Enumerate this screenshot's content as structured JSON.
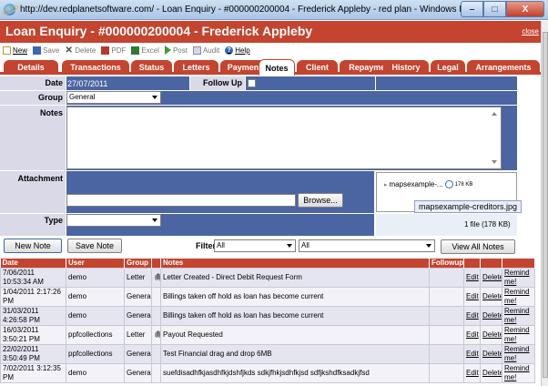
{
  "window": {
    "title": "http://dev.redplanetsoftware.com/ - Loan Enquiry - #000000200004 - Frederick Appleby - red plan - Windows Internet Explorer",
    "min": "–",
    "max": "□",
    "close": "X"
  },
  "header": {
    "title": "Loan Enquiry - #000000200004 - Frederick Appleby",
    "close": "close"
  },
  "toolbar": [
    {
      "label": "New",
      "icon": "new-icon",
      "active": true
    },
    {
      "label": "Save",
      "icon": "save-icon",
      "active": false
    },
    {
      "label": "Delete",
      "icon": "delete-icon",
      "active": false
    },
    {
      "label": "PDF",
      "icon": "pdf-icon",
      "active": false
    },
    {
      "label": "Excel",
      "icon": "excel-icon",
      "active": false
    },
    {
      "label": "Post",
      "icon": "post-icon",
      "active": false
    },
    {
      "label": "Audit",
      "icon": "audit-icon",
      "active": false
    },
    {
      "label": "Help",
      "icon": "help-icon",
      "active": true
    }
  ],
  "tabs": [
    "Details",
    "Transactions",
    "Status",
    "Letters",
    "Payments",
    "Notes",
    "Client",
    "Repayments",
    "History",
    "Legal",
    "Arrangements"
  ],
  "active_tab": "Notes",
  "form": {
    "date_label": "Date",
    "date_value": "27/07/2011",
    "followup_label": "Follow Up",
    "group_label": "Group",
    "group_value": "General",
    "notes_label": "Notes",
    "attachment_label": "Attachment",
    "attachment_file": "mapsexample-...",
    "attachment_size": "178 KB",
    "attachment_tooltip": "mapsexample-creditors.jpg",
    "attachment_count": "1 file (178 KB)",
    "browse_label": "Browse...",
    "type_label": "Type",
    "type_value": ""
  },
  "actions": {
    "new_note": "New Note",
    "save_note": "Save Note",
    "filter_label": "Filter",
    "filter_1": "All",
    "filter_2": "All",
    "view_all": "View All Notes"
  },
  "table": {
    "headers": [
      "Date",
      "User",
      "Group",
      "",
      "Notes",
      "Followup",
      "",
      "",
      ""
    ],
    "rows": [
      {
        "date": "7/06/2011 10:53:34 AM",
        "user": "demo",
        "group": "Letter",
        "clip": "🖇",
        "notes": "Letter Created - Direct Debit Request Form",
        "followup": "",
        "edit": "Edit",
        "delete": "Delete",
        "remind": "Remind me!"
      },
      {
        "date": "1/04/2011 2:17:26 PM",
        "user": "demo",
        "group": "General",
        "clip": "",
        "notes": "Billings taken off hold as loan has become current",
        "followup": "",
        "edit": "Edit",
        "delete": "Delete",
        "remind": "Remind me!"
      },
      {
        "date": "31/03/2011 4:26:58 PM",
        "user": "demo",
        "group": "General",
        "clip": "",
        "notes": "Billings taken off hold as loan has become current",
        "followup": "",
        "edit": "Edit",
        "delete": "Delete",
        "remind": "Remind me!"
      },
      {
        "date": "16/03/2011 3:50:21 PM",
        "user": "ppfcollections",
        "group": "Letter",
        "clip": "🖇",
        "notes": "Payout Requested",
        "followup": "",
        "edit": "Edit",
        "delete": "Delete",
        "remind": "Remind me!"
      },
      {
        "date": "22/02/2011 3:50:49 PM",
        "user": "ppfcollections",
        "group": "General",
        "clip": "",
        "notes": "Test Financial drag and drop 6MB",
        "followup": "",
        "edit": "Edit",
        "delete": "Delete",
        "remind": "Remind me!"
      },
      {
        "date": "7/02/2011 3:12:35 PM",
        "user": "demo",
        "group": "General",
        "clip": "",
        "notes": "suefdisadhfkjasdhfkjdshfjkds sdkjfhkjsdhfkjsd sdfjkshdfksadkjfsd",
        "followup": "",
        "edit": "Edit",
        "delete": "Delete",
        "remind": "Remind me!"
      }
    ]
  },
  "colors": {
    "brand": "#c4442f",
    "panel": "#4b65a3",
    "label_bg": "#d9d9e8"
  }
}
